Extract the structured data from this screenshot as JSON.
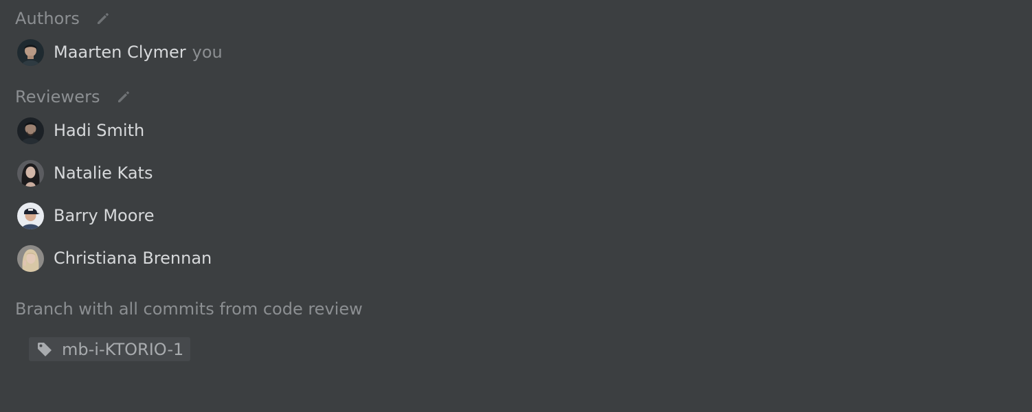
{
  "authors": {
    "title": "Authors",
    "people": [
      {
        "name": "Maarten Clymer",
        "suffix": "you",
        "avatar_icon": "avatar-dark-hair-man"
      }
    ]
  },
  "reviewers": {
    "title": "Reviewers",
    "people": [
      {
        "name": "Hadi Smith",
        "avatar_icon": "avatar-man-dark"
      },
      {
        "name": "Natalie Kats",
        "avatar_icon": "avatar-woman-dark-hair"
      },
      {
        "name": "Barry Moore",
        "avatar_icon": "avatar-man-cap"
      },
      {
        "name": "Christiana Brennan",
        "avatar_icon": "avatar-woman-blonde"
      }
    ]
  },
  "branch": {
    "title": "Branch with all commits from code review",
    "name": "mb-i-KTORIO-1",
    "icon": "tag-icon"
  },
  "colors": {
    "background": "#3c3f41",
    "muted_text": "#8c8f92",
    "primary_text": "#d7d9db",
    "chip_bg": "#46494c"
  }
}
